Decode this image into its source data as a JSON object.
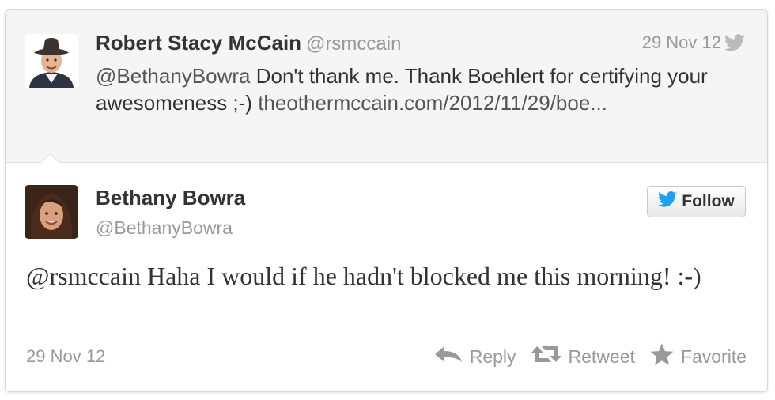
{
  "parent_tweet": {
    "author_name": "Robert Stacy McCain",
    "author_handle": "@rsmccain",
    "date": "29 Nov 12",
    "mention": "@BethanyBowra",
    "text": " Don't thank me. Thank Boehlert for certifying your awesomeness ;-) ",
    "link": "theothermccain.com/2012/11/29/boe..."
  },
  "main_tweet": {
    "author_name": "Bethany Bowra",
    "author_handle": "@BethanyBowra",
    "follow_label": "Follow",
    "mention": "@rsmccain",
    "text": " Haha I would if he hadn't blocked me this morning! :-)",
    "date": "29 Nov 12"
  },
  "actions": {
    "reply": "Reply",
    "retweet": "Retweet",
    "favorite": "Favorite"
  },
  "colors": {
    "twitter_blue": "#1da1f2",
    "muted": "#999999",
    "text": "#333333"
  },
  "icons": [
    "twitter-bird-icon",
    "reply-icon",
    "retweet-icon",
    "star-icon"
  ]
}
